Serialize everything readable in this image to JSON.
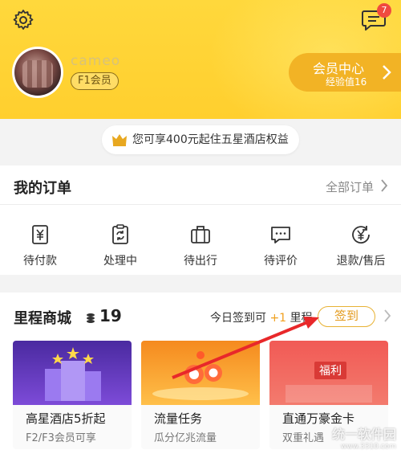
{
  "header": {
    "username": "cameo",
    "level": "F1会员",
    "notification_count": "7",
    "vip_center": {
      "title": "会员中心",
      "exp": "经验值16"
    },
    "perk_text": "您可享400元起住五星酒店权益"
  },
  "orders": {
    "title": "我的订单",
    "all_orders": "全部订单",
    "items": [
      {
        "label": "待付款",
        "icon": "yen-bill-icon"
      },
      {
        "label": "处理中",
        "icon": "refresh-clipboard-icon"
      },
      {
        "label": "待出行",
        "icon": "suitcase-icon"
      },
      {
        "label": "待评价",
        "icon": "comment-icon"
      },
      {
        "label": "退款/售后",
        "icon": "refund-yen-icon"
      }
    ]
  },
  "mall": {
    "title": "里程商城",
    "points": "19",
    "sign_prefix": "今日签到可",
    "sign_bonus": "+1",
    "sign_suffix": "里程",
    "sign_button": "签到",
    "cards": [
      {
        "title": "高星酒店5折起",
        "subtitle": "F2/F3会员可享"
      },
      {
        "title": "流量任务",
        "subtitle": "瓜分亿兆流量"
      },
      {
        "title": "直通万豪金卡",
        "subtitle": "双重礼遇",
        "image_text": "福利"
      }
    ]
  },
  "watermark": {
    "line1": "统一软件园",
    "line2": "www.3310.com"
  },
  "colors": {
    "header": "#ffd83c",
    "accent": "#f2b325",
    "arrow": "#e8282a"
  }
}
